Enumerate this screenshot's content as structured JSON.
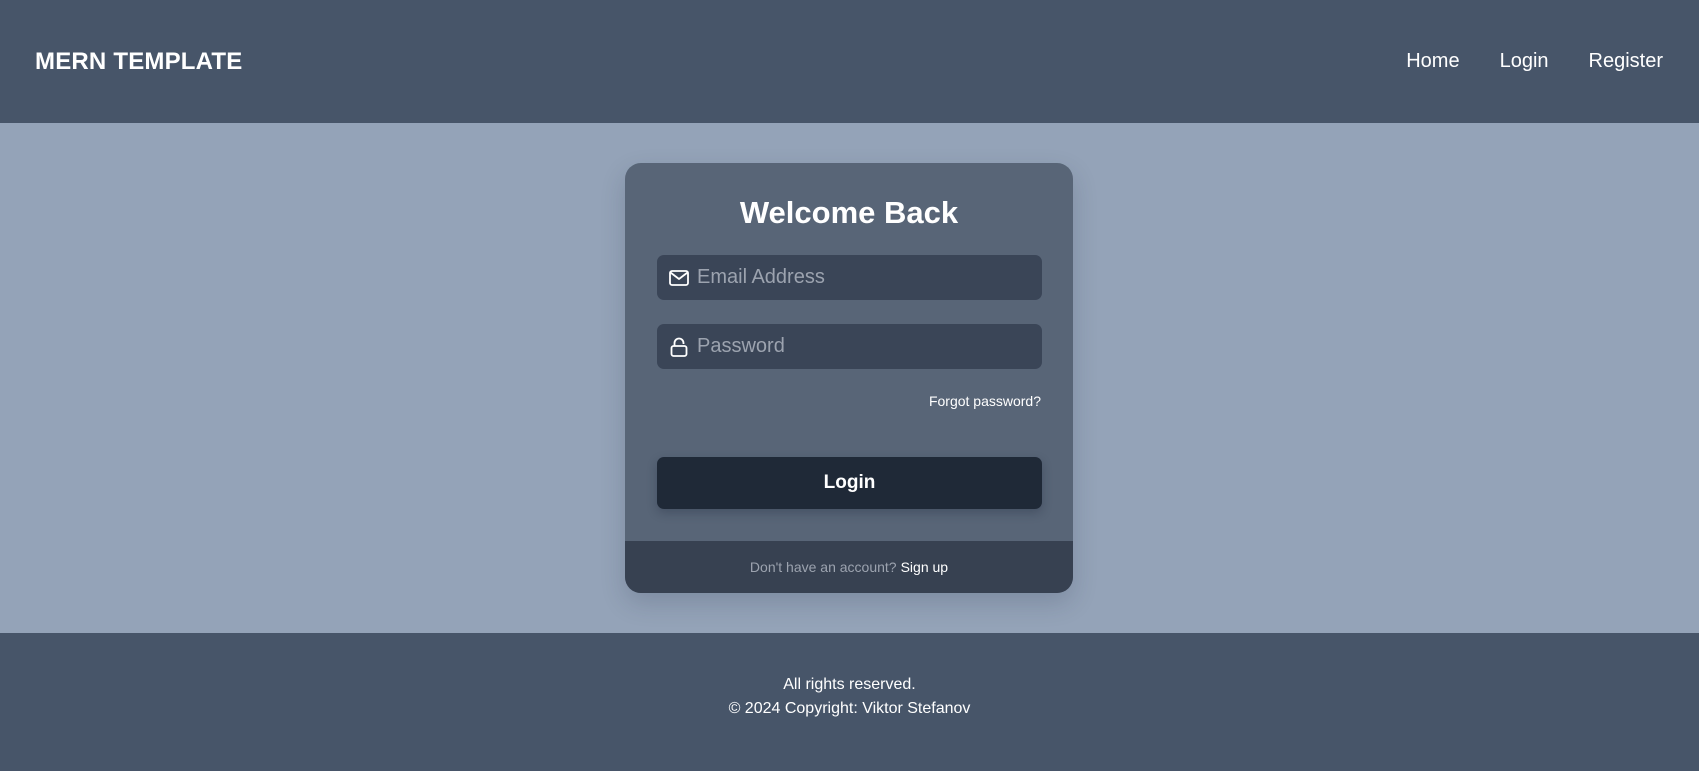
{
  "navbar": {
    "brand": "MERN TEMPLATE",
    "links": [
      {
        "label": "Home"
      },
      {
        "label": "Login"
      },
      {
        "label": "Register"
      }
    ]
  },
  "login_card": {
    "title": "Welcome Back",
    "email": {
      "value": "",
      "placeholder": "Email Address",
      "icon": "mail-icon"
    },
    "password": {
      "value": "",
      "placeholder": "Password",
      "icon": "lock-icon"
    },
    "forgot_label": "Forgot password?",
    "submit_label": "Login",
    "footer": {
      "prompt": "Don't have an account?",
      "signup_label": "Sign up"
    }
  },
  "footer": {
    "rights": "All rights reserved.",
    "copyright": "© 2024 Copyright: Viktor Stefanov"
  },
  "colors": {
    "navbar_bg": "#475569",
    "page_bg": "#94a3b8",
    "card_bg": "#586577",
    "input_bg": "#3a4557",
    "button_bg": "#1f2937",
    "card_footer_bg": "#374151"
  }
}
